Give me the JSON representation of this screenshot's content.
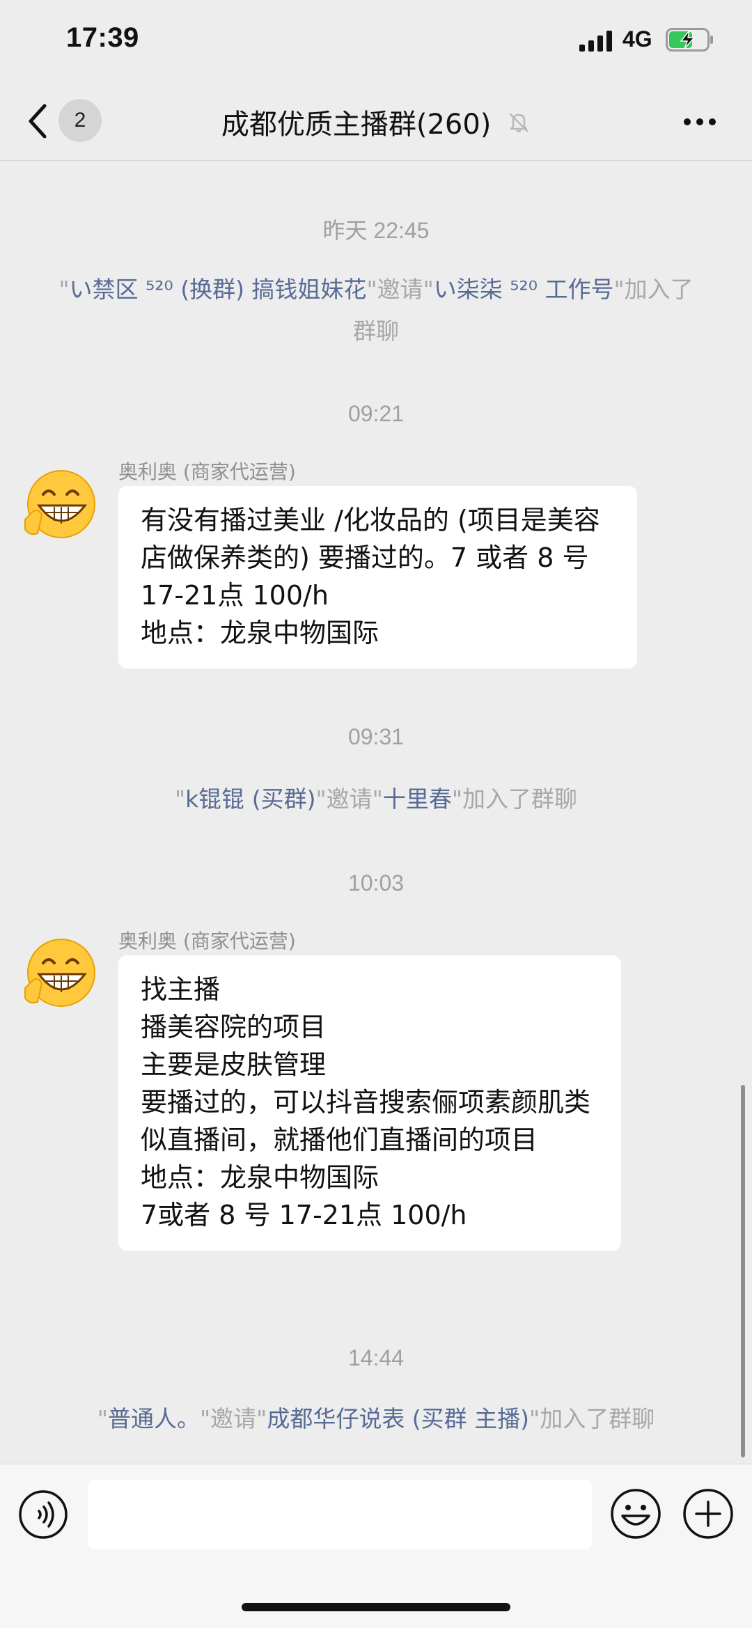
{
  "status_bar": {
    "time": "17:39",
    "network": "4G",
    "battery_icon": "battery-charging-icon"
  },
  "nav": {
    "back_badge": "2",
    "title": "成都优质主播群(260)",
    "mute_icon": "bell-slash-icon",
    "more_icon": "more-dots-icon"
  },
  "messages": [
    {
      "kind": "timestamp",
      "text": "昨天 22:45"
    },
    {
      "kind": "system",
      "parts": [
        {
          "text": "\"",
          "hl": false
        },
        {
          "text": "い禁区 ⁵²⁰ (换群) 搞钱姐妹花",
          "hl": true
        },
        {
          "text": "\"邀请\"",
          "hl": false
        },
        {
          "text": "い柒柒 ⁵²⁰ 工作号",
          "hl": true
        },
        {
          "text": "\"加入了群聊",
          "hl": false
        }
      ]
    },
    {
      "kind": "timestamp",
      "text": "09:21"
    },
    {
      "kind": "message",
      "sender": "奥利奥 (商家代运营)",
      "text": "有没有播过美业 /化妆品的 (项目是美容店做保养类的) 要播过的。7 或者 8 号 17-21点 100/h\n地点：龙泉中物国际"
    },
    {
      "kind": "timestamp",
      "text": "09:31"
    },
    {
      "kind": "system",
      "parts": [
        {
          "text": "\"",
          "hl": false
        },
        {
          "text": "k锟锟 (买群)",
          "hl": true
        },
        {
          "text": "\"邀请\"",
          "hl": false
        },
        {
          "text": "十里春",
          "hl": true
        },
        {
          "text": "\"加入了群聊",
          "hl": false
        }
      ]
    },
    {
      "kind": "timestamp",
      "text": "10:03"
    },
    {
      "kind": "message",
      "sender": "奥利奥 (商家代运营)",
      "text": "找主播\n播美容院的项目\n主要是皮肤管理\n要播过的，可以抖音搜索俪项素颜肌类似直播间，就播他们直播间的项目\n地点：龙泉中物国际\n7或者 8 号 17-21点 100/h"
    },
    {
      "kind": "timestamp",
      "text": "14:44"
    },
    {
      "kind": "system",
      "parts": [
        {
          "text": "\"",
          "hl": false
        },
        {
          "text": "普通人。",
          "hl": true
        },
        {
          "text": "\"邀请\"",
          "hl": false
        },
        {
          "text": "成都华仔说表 (买群 主播)",
          "hl": true
        },
        {
          "text": "\"加入了群聊",
          "hl": false
        }
      ]
    }
  ],
  "input_bar": {
    "voice_icon": "voice-icon",
    "input_value": "",
    "emoji_icon": "emoji-icon",
    "plus_icon": "plus-icon"
  }
}
